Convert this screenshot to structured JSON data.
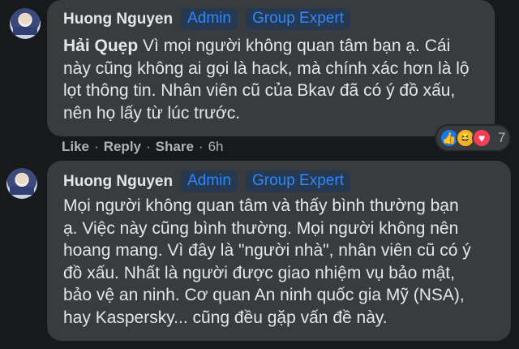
{
  "comments": [
    {
      "author": "Huong Nguyen",
      "badges": [
        "Admin",
        "Group Expert"
      ],
      "mention": "Hải Quẹp",
      "lines": [
        " Vì mọi người không quan tâm bạn ạ. Cái",
        "này cũng không ai gọi là hack, mà chính xác hơn là lộ",
        "lọt thông tin. Nhân viên cũ của Bkav đã có ý đồ xấu,",
        "nên họ lấy từ lúc trước."
      ],
      "actions": {
        "like": "Like",
        "reply": "Reply",
        "share": "Share",
        "time": "6h",
        "sep": "·"
      },
      "reactions": {
        "icons": [
          "like-icon",
          "haha-icon",
          "love-icon"
        ],
        "count": "7"
      }
    },
    {
      "author": "Huong Nguyen",
      "badges": [
        "Admin",
        "Group Expert"
      ],
      "lines": [
        "Mọi người không quan tâm và thấy bình thường bạn",
        "ạ. Việc này cũng bình thường. Mọi người không nên",
        "hoang mang. Vì đây là \"người nhà\", nhân viên cũ có ý",
        "đồ xấu. Nhất là người được giao nhiệm vụ bảo mật,",
        "bảo vệ an ninh. Cơ quan An ninh quốc gia Mỹ (NSA),",
        "hay Kaspersky... cũng đều gặp vấn đề này."
      ]
    }
  ],
  "colors": {
    "background": "#18191a",
    "bubble": "#3a3b3c",
    "badge_text": "#2d88ff",
    "badge_bg": "#263951"
  }
}
